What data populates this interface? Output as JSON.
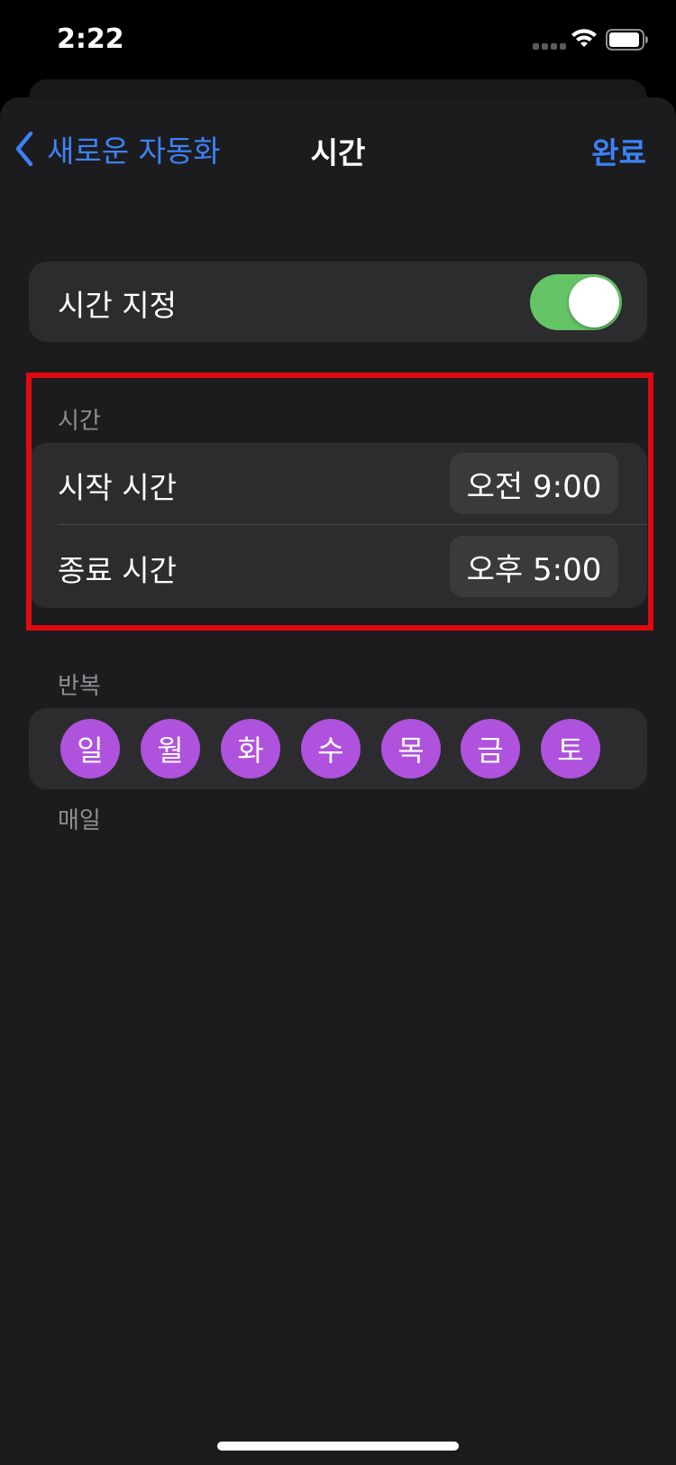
{
  "status_bar": {
    "time": "2:22"
  },
  "nav": {
    "back_label": "새로운 자동화",
    "title": "시간",
    "done_label": "완료"
  },
  "time_setting": {
    "label": "시간 지정",
    "enabled": true
  },
  "time_section": {
    "header": "시간",
    "start_label": "시작 시간",
    "start_value": "오전 9:00",
    "end_label": "종료 시간",
    "end_value": "오후 5:00"
  },
  "repeat_section": {
    "header": "반복",
    "days": [
      "일",
      "월",
      "화",
      "수",
      "목",
      "금",
      "토"
    ],
    "footer": "매일"
  },
  "colors": {
    "accent": "#3c82f6",
    "toggle_on": "#65c466",
    "day_selected": "#af52de",
    "highlight_border": "#e0090f"
  }
}
